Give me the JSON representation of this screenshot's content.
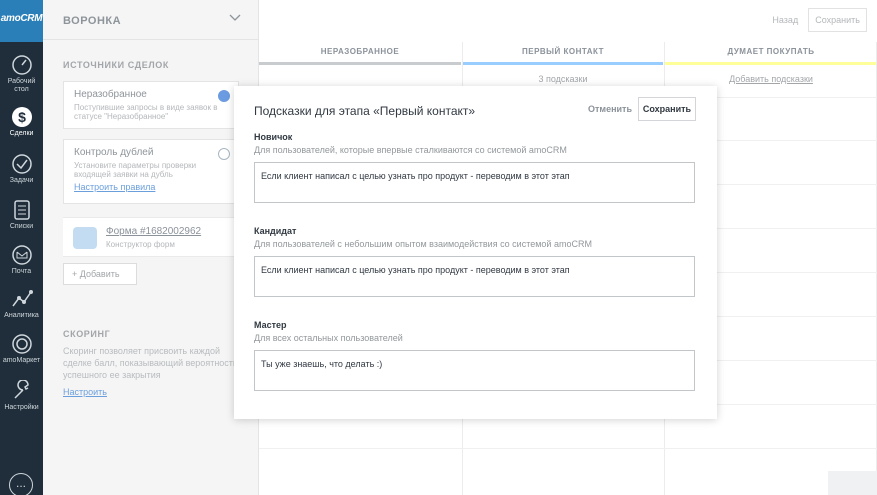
{
  "nav": {
    "logo": "amoCRM",
    "items": [
      {
        "label": "Рабочий стол",
        "icon": "dashboard-icon"
      },
      {
        "label": "Сделки",
        "icon": "deals-icon"
      },
      {
        "label": "Задачи",
        "icon": "tasks-icon"
      },
      {
        "label": "Списки",
        "icon": "lists-icon"
      },
      {
        "label": "Почта",
        "icon": "mail-icon"
      },
      {
        "label": "Аналитика",
        "icon": "analytics-icon"
      },
      {
        "label": "amoМаркет",
        "icon": "market-icon"
      },
      {
        "label": "Настройки",
        "icon": "settings-icon"
      }
    ],
    "more": "..."
  },
  "panel": {
    "title": "ВОРОНКА",
    "sources_title": "ИСТОЧНИКИ СДЕЛОК",
    "unsorted": {
      "title": "Неразобранное",
      "desc": "Поступившие запросы в виде заявок в статусе \"Неразобранное\""
    },
    "duplicates": {
      "title": "Контроль дублей",
      "desc": "Установите параметры проверки входящей заявки на дубль",
      "link": "Настроить правила"
    },
    "form": {
      "title": "Форма #1682002962",
      "subtitle": "Конструктор форм"
    },
    "add_label": "+ Добавить",
    "scoring_title": "СКОРИНГ",
    "scoring_desc": "Скоринг позволяет присвоить каждой сделке балл, показывающий вероятность успешного ее закрытия",
    "scoring_link": "Настроить"
  },
  "board": {
    "back": "Назад",
    "save": "Сохранить",
    "columns": [
      {
        "name": "НЕРАЗОБРАННОЕ",
        "hint": "",
        "color": "#c9cccf"
      },
      {
        "name": "ПЕРВЫЙ КОНТАКТ",
        "hint": "3 подсказки",
        "color": "#99ccff"
      },
      {
        "name": "ДУМАЕТ ПОКУПАТЬ",
        "hint": "Добавить подсказки",
        "color": "#ffff99"
      }
    ]
  },
  "modal": {
    "title": "Подсказки для этапа «Первый контакт»",
    "cancel": "Отменить",
    "save": "Сохранить",
    "levels": [
      {
        "name": "Новичок",
        "desc": "Для пользователей, которые впервые сталкиваются со системой amoCRM",
        "value": "Если клиент написал с целью узнать про продукт - переводим в этот этап"
      },
      {
        "name": "Кандидат",
        "desc": "Для пользователей с небольшим опытом взаимодействия со системой amoCRM",
        "value": "Если клиент написал с целью узнать про продукт - переводим в этот этап"
      },
      {
        "name": "Мастер",
        "desc": "Для всех остальных пользователей",
        "value": "Ты уже знаешь, что делать :)"
      }
    ]
  }
}
